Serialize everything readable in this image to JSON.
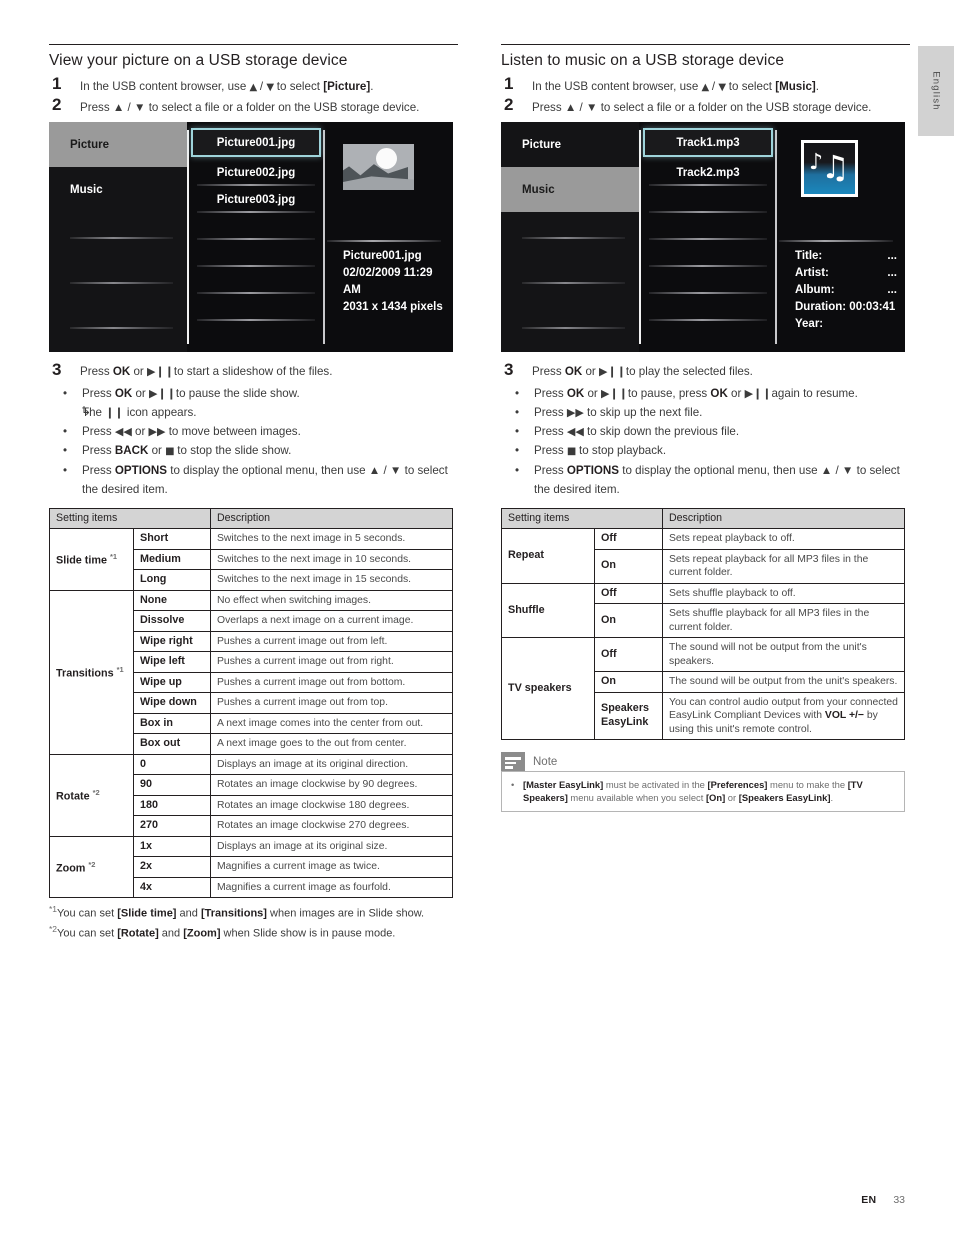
{
  "side_tab": {
    "label": "English"
  },
  "footer": {
    "lang_code": "EN",
    "page_number": "33"
  },
  "left": {
    "section_title": "View your picture on a USB storage device",
    "steps": [
      {
        "num": "1",
        "pre": "In the USB content browser, use ",
        "g1": "▲",
        "sep": " / ",
        "g2": "▼",
        "post": " to select ",
        "bold": "[Picture]",
        "end": "."
      },
      {
        "num": "2",
        "text": "Press ▲ / ▼ to select a file or a folder on the USB storage device."
      }
    ],
    "tv": {
      "sidebar": [
        {
          "label": "Picture",
          "active": true
        },
        {
          "label": "Music",
          "active": false
        }
      ],
      "files": [
        "Picture001.jpg",
        "Picture002.jpg",
        "Picture003.jpg"
      ],
      "selected_file": "Picture001.jpg",
      "thumbnail": "landscape-sunset-thumbnail",
      "detail": {
        "filename": "Picture001.jpg",
        "datetime": "02/02/2009 11:29 AM",
        "dimensions": "2031 x 1434 pixels"
      }
    },
    "step3": {
      "num": "3",
      "lead_pre": "Press ",
      "lead_b1": "OK",
      "lead_mid": " or ",
      "lead_g": "▶❙❙",
      "lead_post": "to start a slideshow of the files.",
      "bullets": [
        {
          "pre": "Press ",
          "b1": "OK",
          "mid": " or ",
          "g": "▶❙❙",
          "post": "to pause the slide show."
        },
        {
          "arrow": true,
          "pre": "The ",
          "g": "❙❙",
          "post": " icon appears."
        },
        {
          "pre": "Press ",
          "g1": "◀◀",
          "mid": " or ",
          "g2": "▶▶",
          "post": " to move between images."
        },
        {
          "pre": "Press ",
          "b1": "BACK",
          "mid": " or ",
          "g": "■",
          "post": " to stop the slide show."
        },
        {
          "pre": "Press ",
          "b1": "OPTIONS",
          "post": " to display the optional menu, then use ▲ / ▼ to select the desired item."
        }
      ]
    },
    "table": {
      "headers": [
        "Setting items",
        "Description"
      ],
      "groups": [
        {
          "name": "Slide time",
          "footnote": "*1",
          "rows": [
            {
              "option": "Short",
              "description": "Switches to the next image in 5 seconds."
            },
            {
              "option": "Medium",
              "description": "Switches to the next image in 10 seconds."
            },
            {
              "option": "Long",
              "description": "Switches to the next image in 15 seconds."
            }
          ]
        },
        {
          "name": "Transitions",
          "footnote": "*1",
          "rows": [
            {
              "option": "None",
              "description": "No effect when switching images."
            },
            {
              "option": "Dissolve",
              "description": "Overlaps a next image on a current image."
            },
            {
              "option": "Wipe right",
              "description": "Pushes a current image out from left."
            },
            {
              "option": "Wipe left",
              "description": "Pushes a current image out from right."
            },
            {
              "option": "Wipe up",
              "description": "Pushes a current image out from bottom."
            },
            {
              "option": "Wipe down",
              "description": "Pushes a current image out from top."
            },
            {
              "option": "Box in",
              "description": "A next image comes into the center from out."
            },
            {
              "option": "Box out",
              "description": "A next image goes to the out from center."
            }
          ]
        },
        {
          "name": "Rotate",
          "footnote": "*2",
          "rows": [
            {
              "option": "0",
              "description": "Displays an image at its original direction."
            },
            {
              "option": "90",
              "description": "Rotates an image clockwise by 90 degrees."
            },
            {
              "option": "180",
              "description": "Rotates an image clockwise 180 degrees."
            },
            {
              "option": "270",
              "description": "Rotates an image clockwise 270 degrees."
            }
          ]
        },
        {
          "name": "Zoom",
          "footnote": "*2",
          "rows": [
            {
              "option": "1x",
              "description": "Displays an image at its original size."
            },
            {
              "option": "2x",
              "description": "Magnifies a current image as twice."
            },
            {
              "option": "4x",
              "description": "Magnifies a current image as fourfold."
            }
          ]
        }
      ]
    },
    "footnotes": [
      {
        "mark": "*1",
        "pre": "You can set ",
        "b1": "[Slide time]",
        "mid": " and ",
        "b2": "[Transitions]",
        "post": " when images are in Slide show."
      },
      {
        "mark": "*2",
        "pre": "You can set ",
        "b1": "[Rotate]",
        "mid": " and ",
        "b2": "[Zoom]",
        "post": " when Slide show is in pause mode."
      }
    ]
  },
  "right": {
    "section_title": "Listen to music on a USB storage device",
    "steps": [
      {
        "num": "1",
        "pre": "In the USB content browser, use ",
        "g1": "▲",
        "sep": " / ",
        "g2": "▼",
        "post": " to select ",
        "bold": "[Music]",
        "end": "."
      },
      {
        "num": "2",
        "text": "Press ▲ / ▼ to select a file or a folder on the USB storage device."
      }
    ],
    "tv": {
      "sidebar": [
        {
          "label": "Picture",
          "active": false
        },
        {
          "label": "Music",
          "active": true
        }
      ],
      "files": [
        "Track1.mp3",
        "Track2.mp3"
      ],
      "selected_file": "Track1.mp3",
      "thumbnail": "music-notes-thumbnail",
      "detail": {
        "title_label": "Title:",
        "title_value": "...",
        "artist_label": "Artist:",
        "artist_value": "...",
        "album_label": "Album:",
        "album_value": "...",
        "duration_label": "Duration: 00:03:41",
        "year_label": "Year:"
      }
    },
    "step3": {
      "num": "3",
      "lead_pre": "Press ",
      "lead_b1": "OK",
      "lead_mid": " or ",
      "lead_g": "▶❙❙",
      "lead_post": "to play the selected files.",
      "bullets": [
        {
          "pre": "Press ",
          "b1": "OK",
          "mid": " or ",
          "g": "▶❙❙",
          "post": "to pause, press ",
          "b2": "OK",
          "mid2": " or ",
          "g2": "▶❙❙",
          "post2": "again to resume."
        },
        {
          "pre": "Press ",
          "g1": "▶▶",
          "post": " to skip up the next file."
        },
        {
          "pre": "Press ",
          "g1": "◀◀",
          "post": " to skip down the previous file."
        },
        {
          "pre": "Press ",
          "g1": "■",
          "post": " to stop playback."
        },
        {
          "pre": "Press ",
          "b1": "OPTIONS",
          "post": " to display the optional menu, then use ▲ / ▼ to select the desired item."
        }
      ]
    },
    "table": {
      "headers": [
        "Setting items",
        "Description"
      ],
      "groups": [
        {
          "name": "Repeat",
          "rows": [
            {
              "option": "Off",
              "description": "Sets repeat playback to off."
            },
            {
              "option": "On",
              "description": "Sets repeat playback for all MP3 files in the current folder."
            }
          ]
        },
        {
          "name": "Shuffle",
          "rows": [
            {
              "option": "Off",
              "description": "Sets shuffle playback to off."
            },
            {
              "option": "On",
              "description": "Sets shuffle playback for all MP3 files in the current folder."
            }
          ]
        },
        {
          "name": "TV speakers",
          "rows": [
            {
              "option": "Off",
              "description": "The sound will not be output from the unit's speakers."
            },
            {
              "option": "On",
              "description": "The sound will be output from the unit's speakers."
            },
            {
              "option": "Speakers EasyLink",
              "description": "You can control audio output from your connected EasyLink Compliant Devices with VOL +/− by using this unit's remote control.",
              "rich": true
            }
          ]
        }
      ]
    },
    "note": {
      "icon": "note-icon",
      "title": "Note",
      "bullet": {
        "b1": "[Master EasyLink]",
        "t1": " must be activated in the ",
        "b2": "[Preferences]",
        "t2": " menu to make the ",
        "b3": "[TV Speakers]",
        "t3": " menu available when you select ",
        "b4": "[On]",
        "t4": " or ",
        "b5": "[Speakers EasyLink]",
        "t5": "."
      }
    }
  }
}
